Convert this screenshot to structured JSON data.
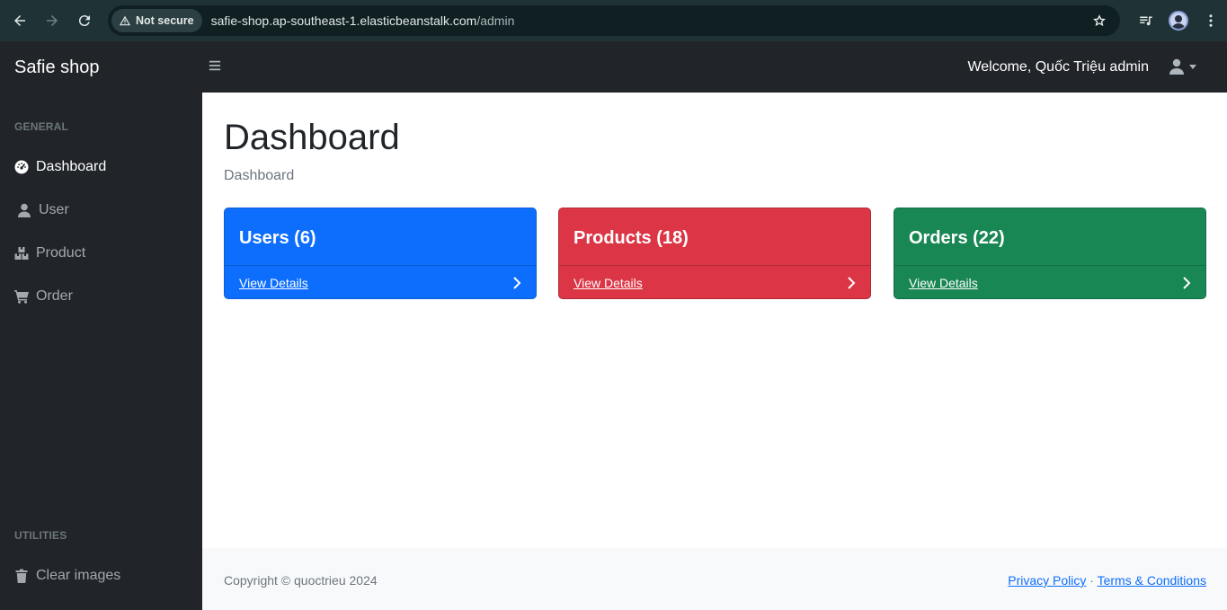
{
  "browser": {
    "security_label": "Not secure",
    "url_host": "safie-shop.ap-southeast-1.elasticbeanstalk.com",
    "url_path": "/admin"
  },
  "navbar": {
    "brand": "Safie shop",
    "welcome": "Welcome, Quốc Triệu admin"
  },
  "sidebar": {
    "heading_general": "GENERAL",
    "items": [
      {
        "label": "Dashboard",
        "icon": "gauge-icon",
        "active": true
      },
      {
        "label": "User",
        "icon": "user-icon"
      },
      {
        "label": "Product",
        "icon": "boxes-icon"
      },
      {
        "label": "Order",
        "icon": "cart-icon"
      }
    ],
    "heading_utilities": "UTILITIES",
    "utility_items": [
      {
        "label": "Clear images",
        "icon": "trash-icon"
      }
    ]
  },
  "main": {
    "title": "Dashboard",
    "breadcrumb": "Dashboard",
    "cards": [
      {
        "title": "Users (6)",
        "link": "View Details",
        "color": "#0d6efd"
      },
      {
        "title": "Products (18)",
        "link": "View Details",
        "color": "#dc3545"
      },
      {
        "title": "Orders (22)",
        "link": "View Details",
        "color": "#198754"
      }
    ]
  },
  "footer": {
    "copyright": "Copyright © quoctrieu 2024",
    "privacy": "Privacy Policy",
    "separator": "·",
    "terms": "Terms & Conditions"
  }
}
